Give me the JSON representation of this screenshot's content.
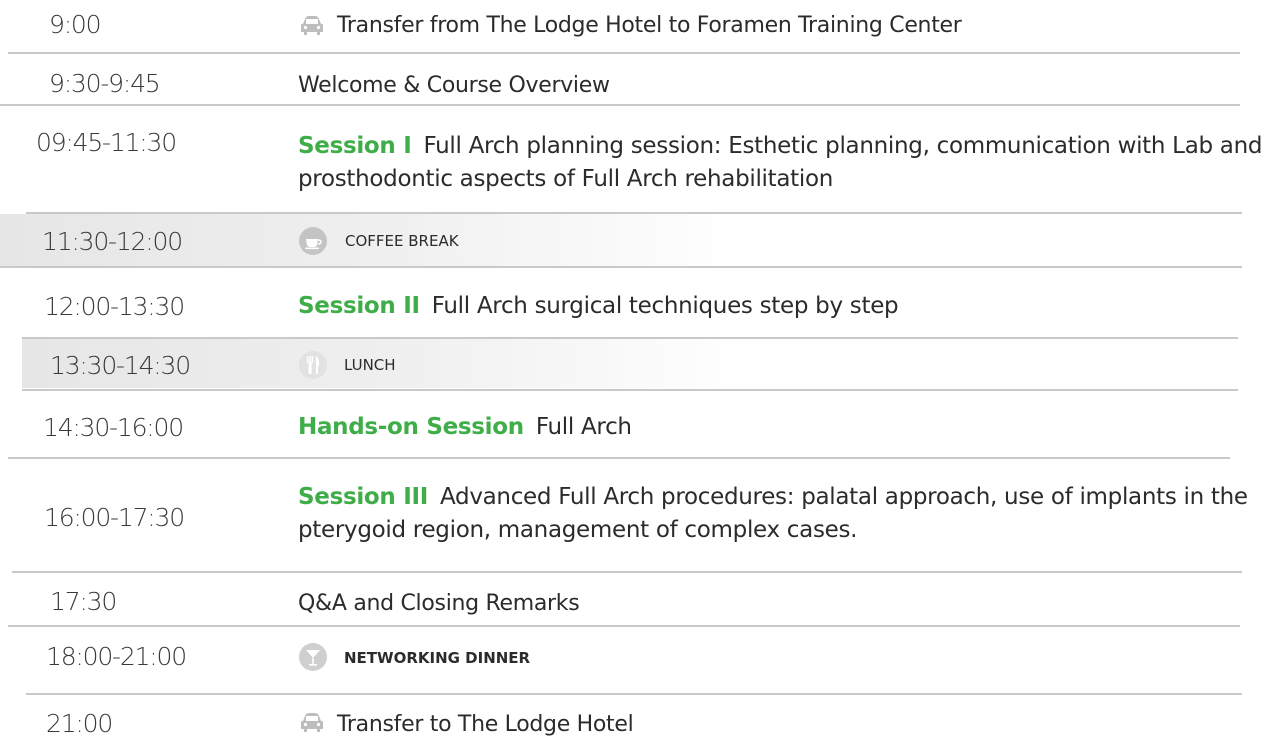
{
  "schedule": {
    "rows": [
      {
        "time": "9:00",
        "text": "Transfer from The Lodge Hotel to Foramen Training Center",
        "icon": "car-icon"
      },
      {
        "time": "9:30-9:45",
        "text": "Welcome & Course Overview"
      },
      {
        "time": "09:45-11:30",
        "tag": "Session I",
        "text": "Full Arch planning session: Esthetic planning, communication with Lab and prosthodontic aspects of Full Arch rehabilitation"
      },
      {
        "time": "11:30-12:00",
        "text": "COFFEE BREAK",
        "icon": "coffee-cup-icon"
      },
      {
        "time": "12:00-13:30",
        "tag": "Session II",
        "text": "Full Arch surgical techniques step by step"
      },
      {
        "time": "13:30-14:30",
        "text": "LUNCH",
        "icon": "fork-knife-icon"
      },
      {
        "time": "14:30-16:00",
        "tag": "Hands-on Session",
        "text": "Full Arch"
      },
      {
        "time": "16:00-17:30",
        "tag": "Session III",
        "text": "Advanced Full Arch procedures: palatal approach, use of implants in the pterygoid region, management of complex cases."
      },
      {
        "time": "17:30",
        "text": "Q&A and Closing Remarks"
      },
      {
        "time": "18:00-21:00",
        "text": "NETWORKING DINNER",
        "icon": "cocktail-glass-icon"
      },
      {
        "time": "21:00",
        "text": "Transfer to The Lodge Hotel",
        "icon": "car-icon"
      }
    ]
  },
  "colors": {
    "accent_green": "#3fae49",
    "divider_gray": "#c9c9c9",
    "icon_gray": "#bdbdbd"
  }
}
